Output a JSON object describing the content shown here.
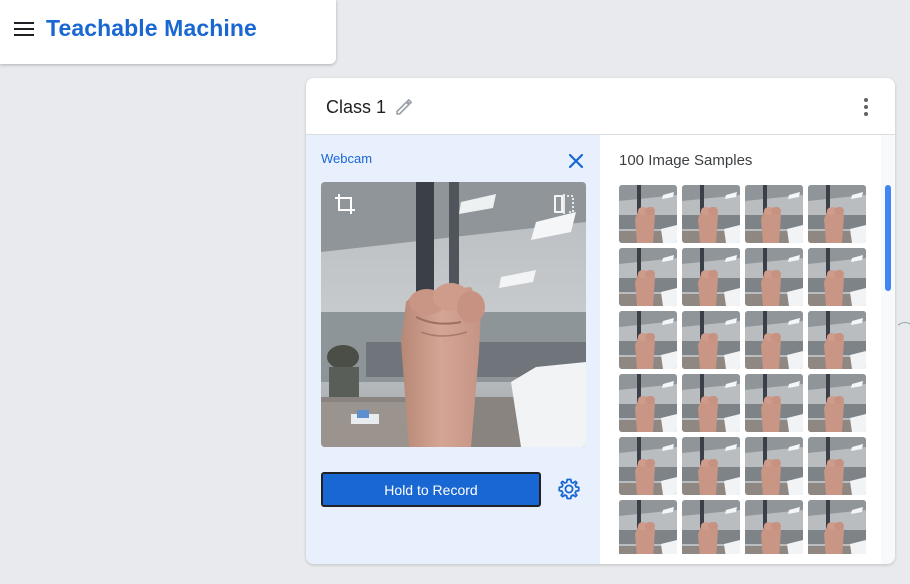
{
  "app": {
    "title": "Teachable Machine",
    "brand_color": "#1967d2"
  },
  "topbar": {
    "menu_icon": "hamburger-menu-icon"
  },
  "class_card": {
    "name": "Class 1",
    "edit_icon": "pencil-icon",
    "more_icon": "more-vert-icon"
  },
  "webcam": {
    "title": "Webcam",
    "close_icon": "close-icon",
    "crop_icon": "crop-icon",
    "flip_icon": "flip-horizontal-icon",
    "record_label": "Hold to Record",
    "settings_icon": "gear-icon",
    "panel_color": "#e8f0fe",
    "button_color": "#1967d2"
  },
  "samples": {
    "title": "100 Image Samples",
    "count": 100
  }
}
